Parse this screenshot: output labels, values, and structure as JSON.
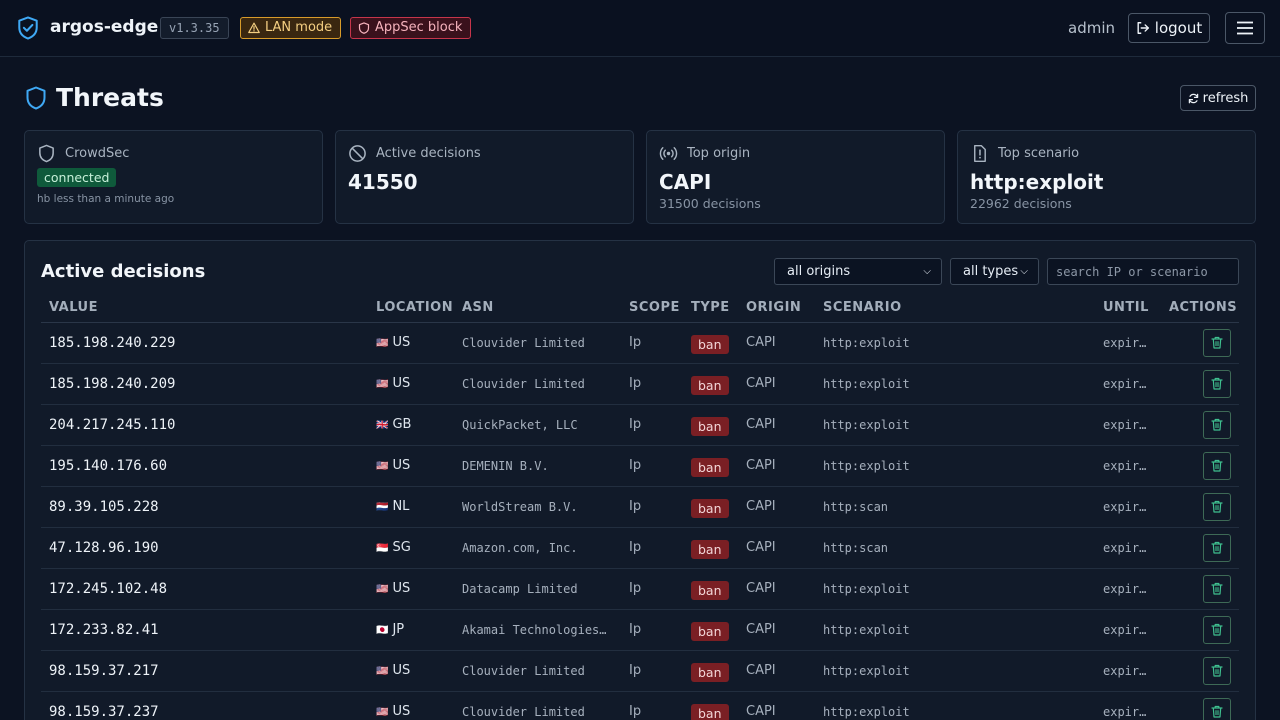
{
  "topbar": {
    "brand": "argos-edge",
    "version": "v1.3.35",
    "lan_badge": "LAN mode",
    "appsec_badge": "AppSec block",
    "user": "admin",
    "logout_label": "logout"
  },
  "page": {
    "title": "Threats",
    "refresh_label": "refresh"
  },
  "cards": {
    "crowdsec": {
      "label": "CrowdSec",
      "status": "connected",
      "heartbeat": "hb less than a minute ago"
    },
    "active": {
      "label": "Active decisions",
      "value": "41550"
    },
    "origin": {
      "label": "Top origin",
      "value": "CAPI",
      "sub": "31500 decisions"
    },
    "scenario": {
      "label": "Top scenario",
      "value": "http:exploit",
      "sub": "22962 decisions"
    }
  },
  "decisions": {
    "title": "Active decisions",
    "origin_filter": "all origins",
    "type_filter": "all types",
    "search_placeholder": "search IP or scenario",
    "columns": [
      "VALUE",
      "LOCATION",
      "ASN",
      "SCOPE",
      "TYPE",
      "ORIGIN",
      "SCENARIO",
      "UNTIL",
      "ACTIONS"
    ],
    "rows": [
      {
        "value": "185.198.240.229",
        "flag": "🇺🇸",
        "country": "US",
        "asn": "Clouvider Limited",
        "scope": "Ip",
        "type": "ban",
        "origin": "CAPI",
        "scenario": "http:exploit",
        "until": "expired"
      },
      {
        "value": "185.198.240.209",
        "flag": "🇺🇸",
        "country": "US",
        "asn": "Clouvider Limited",
        "scope": "Ip",
        "type": "ban",
        "origin": "CAPI",
        "scenario": "http:exploit",
        "until": "expired"
      },
      {
        "value": "204.217.245.110",
        "flag": "🇬🇧",
        "country": "GB",
        "asn": "QuickPacket, LLC",
        "scope": "Ip",
        "type": "ban",
        "origin": "CAPI",
        "scenario": "http:exploit",
        "until": "expired"
      },
      {
        "value": "195.140.176.60",
        "flag": "🇺🇸",
        "country": "US",
        "asn": "DEMENIN B.V.",
        "scope": "Ip",
        "type": "ban",
        "origin": "CAPI",
        "scenario": "http:exploit",
        "until": "expired"
      },
      {
        "value": "89.39.105.228",
        "flag": "🇳🇱",
        "country": "NL",
        "asn": "WorldStream B.V.",
        "scope": "Ip",
        "type": "ban",
        "origin": "CAPI",
        "scenario": "http:scan",
        "until": "expired"
      },
      {
        "value": "47.128.96.190",
        "flag": "🇸🇬",
        "country": "SG",
        "asn": "Amazon.com, Inc.",
        "scope": "Ip",
        "type": "ban",
        "origin": "CAPI",
        "scenario": "http:scan",
        "until": "expired"
      },
      {
        "value": "172.245.102.48",
        "flag": "🇺🇸",
        "country": "US",
        "asn": "Datacamp Limited",
        "scope": "Ip",
        "type": "ban",
        "origin": "CAPI",
        "scenario": "http:exploit",
        "until": "expired"
      },
      {
        "value": "172.233.82.41",
        "flag": "🇯🇵",
        "country": "JP",
        "asn": "Akamai Technologies, Inc.",
        "scope": "Ip",
        "type": "ban",
        "origin": "CAPI",
        "scenario": "http:exploit",
        "until": "expired"
      },
      {
        "value": "98.159.37.217",
        "flag": "🇺🇸",
        "country": "US",
        "asn": "Clouvider Limited",
        "scope": "Ip",
        "type": "ban",
        "origin": "CAPI",
        "scenario": "http:exploit",
        "until": "expired"
      },
      {
        "value": "98.159.37.237",
        "flag": "🇺🇸",
        "country": "US",
        "asn": "Clouvider Limited",
        "scope": "Ip",
        "type": "ban",
        "origin": "CAPI",
        "scenario": "http:exploit",
        "until": "expired"
      }
    ]
  },
  "colors": {
    "background": "#0c1322",
    "card": "#111a29",
    "accent": "#3fa9f5",
    "ban": "#7a1f24",
    "connected": "#0f5a3b",
    "delete_icon": "#3fbf8f"
  },
  "icons": {
    "brand": "shield-check-icon",
    "lan": "warning-triangle-icon",
    "appsec": "shield-icon",
    "logout": "logout-icon",
    "menu": "hamburger-icon",
    "refresh": "refresh-icon",
    "crowdsec": "shield-icon",
    "active": "ban-circle-icon",
    "origin": "broadcast-icon",
    "scenario": "alert-file-icon",
    "delete": "trash-icon"
  }
}
